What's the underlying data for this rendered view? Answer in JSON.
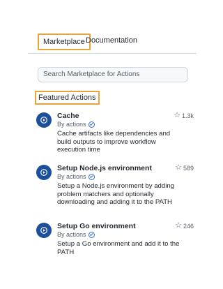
{
  "tabs": {
    "marketplace": "Marketplace",
    "documentation": "Documentation"
  },
  "search": {
    "placeholder": "Search Marketplace for Actions"
  },
  "section": {
    "title": "Featured Actions"
  },
  "actions": [
    {
      "title": "Cache",
      "by": "By actions",
      "description": "Cache artifacts like dependencies and build outputs to improve workflow execution time",
      "stars": "1.3k"
    },
    {
      "title": "Setup Node.js environment",
      "by": "By actions",
      "description": "Setup a Node.js environment by adding problem matchers and optionally downloading and adding it to the PATH",
      "stars": "589"
    },
    {
      "title": "Setup Go environment",
      "by": "By actions",
      "description": "Setup a Go environment and add it to the PATH",
      "stars": "246"
    }
  ],
  "colors": {
    "highlight": "#e8a33d",
    "avatar": "#1c4f9c",
    "verified": "#2f6fd6"
  },
  "icons": {
    "avatar": "play-icon",
    "verified": "verified-check-icon",
    "star": "star-icon"
  }
}
